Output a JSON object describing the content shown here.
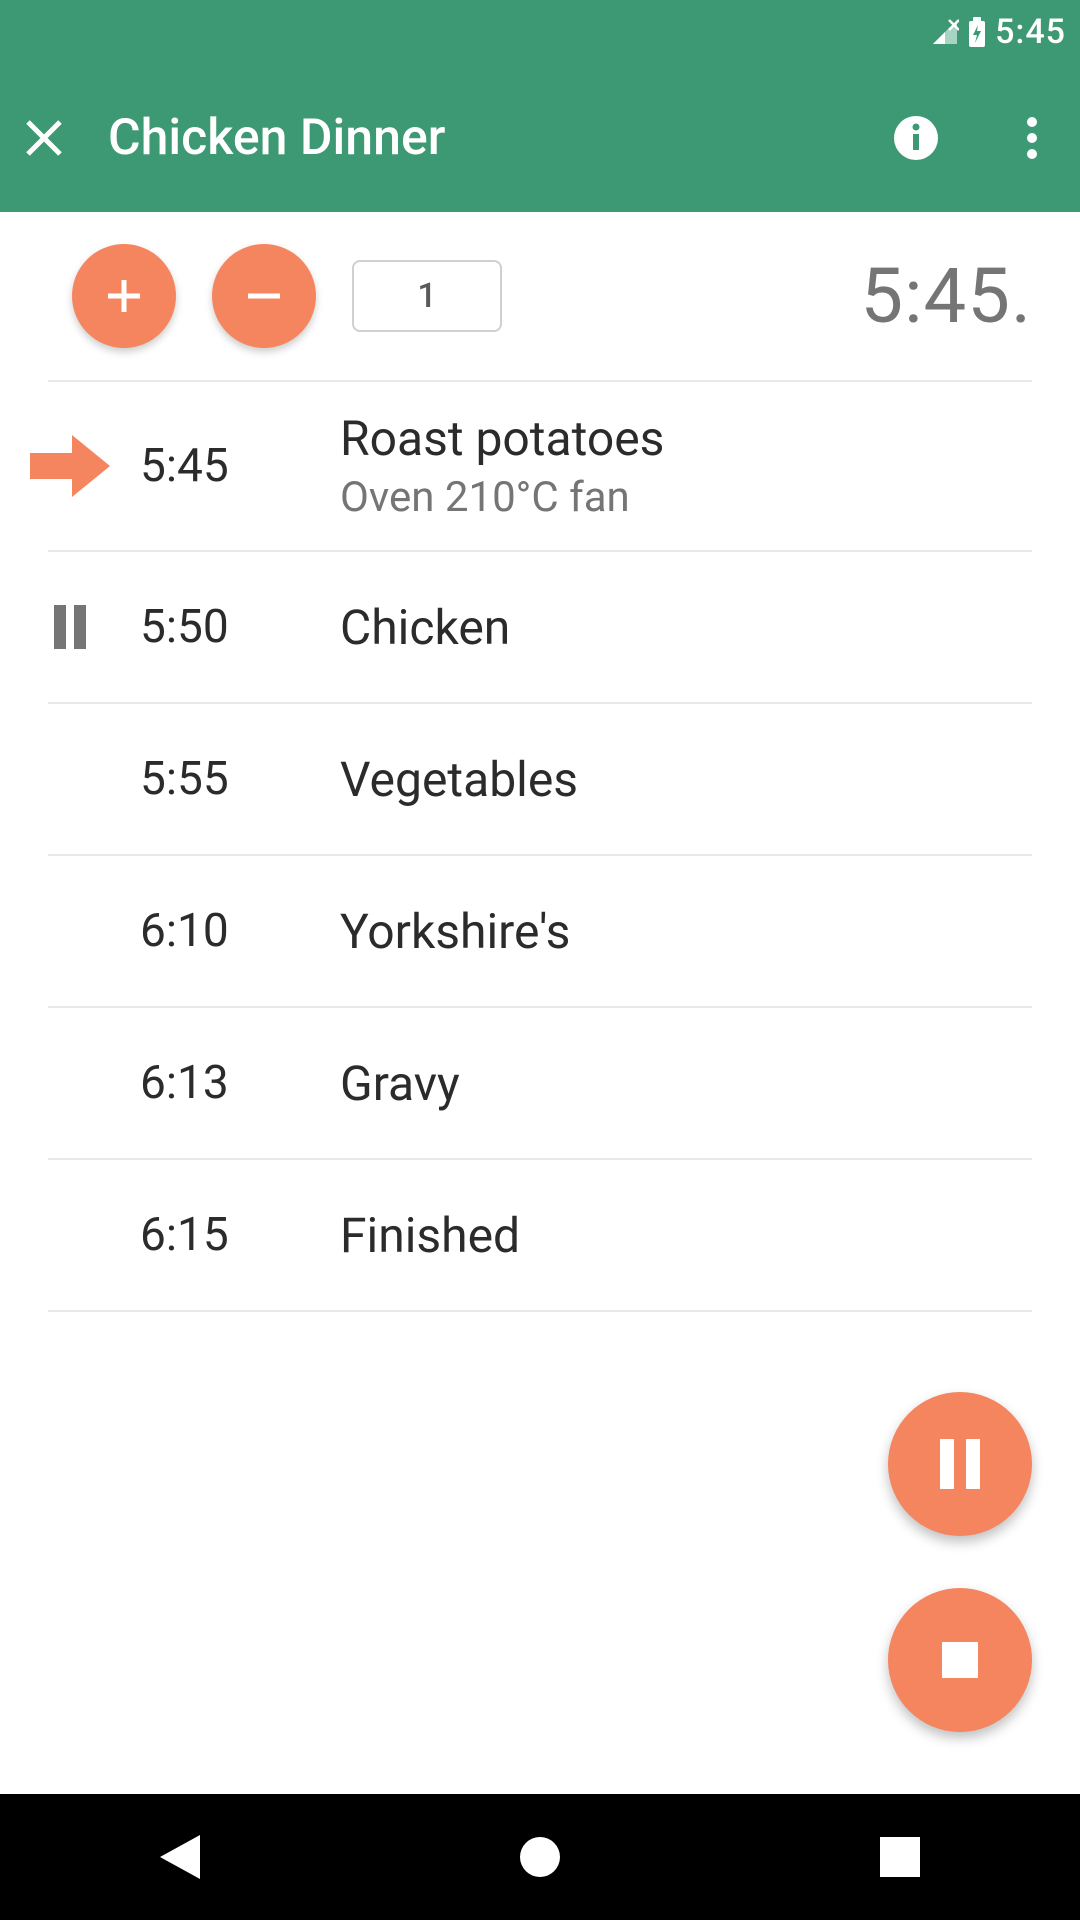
{
  "status": {
    "clock": "5:45"
  },
  "appbar": {
    "title": "Chicken Dinner"
  },
  "controls": {
    "count": "1",
    "big_time": "5:45."
  },
  "steps": [
    {
      "time": "5:45",
      "label": "Roast potatoes",
      "sublabel": "Oven 210°C fan",
      "state": "active"
    },
    {
      "time": "5:50",
      "label": "Chicken",
      "state": "paused"
    },
    {
      "time": "5:55",
      "label": "Vegetables",
      "state": ""
    },
    {
      "time": "6:10",
      "label": "Yorkshire's",
      "state": ""
    },
    {
      "time": "6:13",
      "label": "Gravy",
      "state": ""
    },
    {
      "time": "6:15",
      "label": "Finished",
      "state": ""
    }
  ]
}
